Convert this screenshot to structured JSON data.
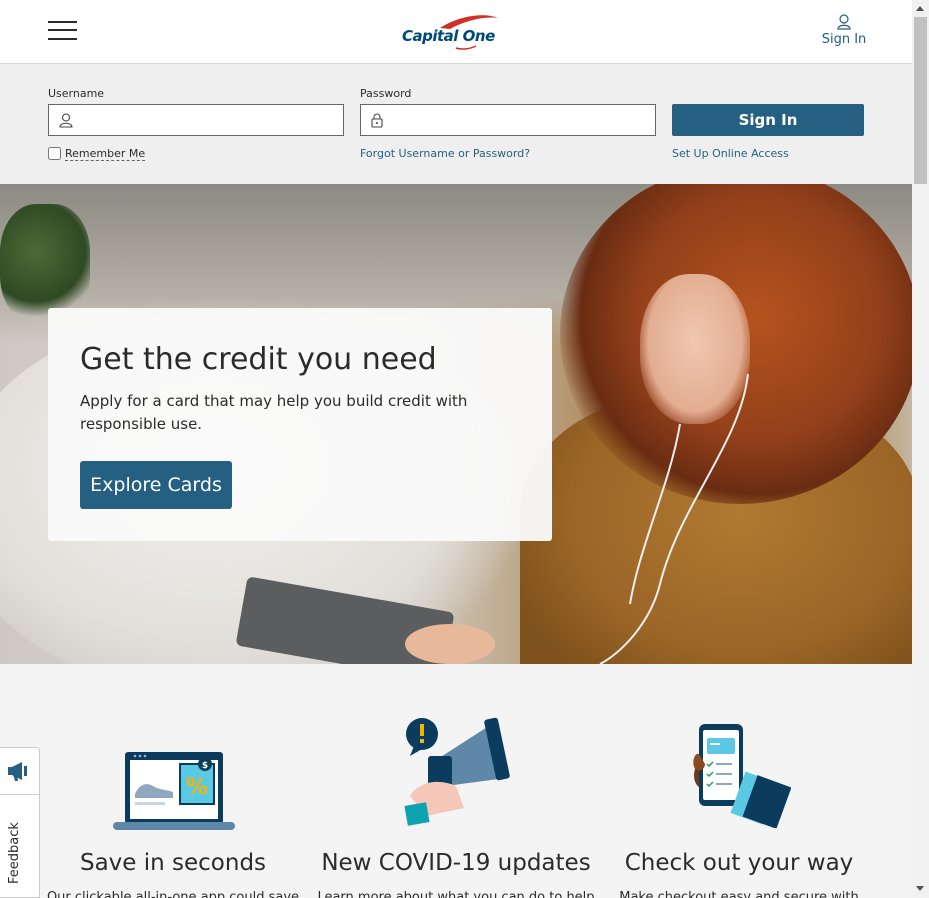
{
  "header": {
    "menu_icon": "hamburger-icon",
    "logo_text": "Capital One",
    "signin_label": "Sign In",
    "signin_icon": "person-icon"
  },
  "login": {
    "username_label": "Username",
    "username_value": "",
    "password_label": "Password",
    "password_value": "",
    "signin_button": "Sign In",
    "remember_label": "Remember Me",
    "remember_checked": false,
    "forgot_link": "Forgot Username or Password?",
    "setup_link": "Set Up Online Access"
  },
  "hero": {
    "title": "Get the credit you need",
    "description": "Apply for a card that may help you build credit with responsible use.",
    "cta": "Explore Cards"
  },
  "features": [
    {
      "icon": "laptop-discount-icon",
      "title": "Save in seconds",
      "desc": "Our clickable all-in-one app could save"
    },
    {
      "icon": "megaphone-icon",
      "title": "New COVID-19 updates",
      "desc": "Learn more about what you can do to help"
    },
    {
      "icon": "phone-checklist-icon",
      "title": "Check out your way",
      "desc": "Make checkout easy and secure with"
    }
  ],
  "feedback": {
    "label": "Feedback",
    "icon": "megaphone-icon"
  },
  "colors": {
    "brand_blue": "#255f82",
    "logo_blue": "#004977",
    "logo_red": "#d03027",
    "band_gray": "#efefef"
  }
}
